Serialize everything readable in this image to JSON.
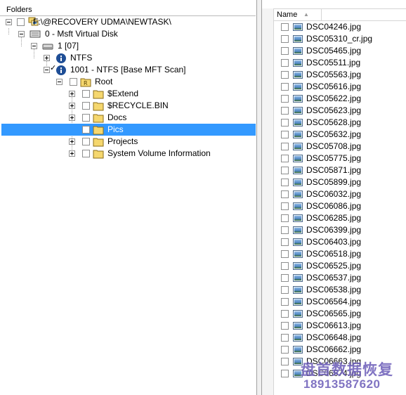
{
  "left_pane": {
    "header": "Folders",
    "tree": [
      {
        "id": "root-path",
        "label": "F:\\@RECOVERY UDMA\\NEWTASK\\",
        "icon": "computer-icon"
      },
      {
        "id": "disk",
        "label": "0 - Msft Virtual Disk",
        "icon": "disk-icon"
      },
      {
        "id": "partition",
        "label": "1 [07]",
        "icon": "drive-icon"
      },
      {
        "id": "ntfs",
        "label": "NTFS",
        "icon": "info-icon"
      },
      {
        "id": "mft-scan",
        "label": "1001 - NTFS [Base MFT Scan]",
        "icon": "info-icon"
      },
      {
        "id": "root",
        "label": "Root",
        "icon": "root-folder-icon"
      },
      {
        "id": "extend",
        "label": "$Extend",
        "icon": "folder-icon"
      },
      {
        "id": "recycle",
        "label": "$RECYCLE.BIN",
        "icon": "folder-icon"
      },
      {
        "id": "docs",
        "label": "Docs",
        "icon": "folder-icon"
      },
      {
        "id": "pics",
        "label": "Pics",
        "icon": "folder-icon"
      },
      {
        "id": "projects",
        "label": "Projects",
        "icon": "folder-icon"
      },
      {
        "id": "svi",
        "label": "System Volume Information",
        "icon": "folder-icon"
      }
    ],
    "selected": "Pics"
  },
  "right_pane": {
    "column_header": "Name",
    "files": [
      "DSC04246.jpg",
      "DSC05310_cr.jpg",
      "DSC05465.jpg",
      "DSC05511.jpg",
      "DSC05563.jpg",
      "DSC05616.jpg",
      "DSC05622.jpg",
      "DSC05623.jpg",
      "DSC05628.jpg",
      "DSC05632.jpg",
      "DSC05708.jpg",
      "DSC05775.jpg",
      "DSC05871.jpg",
      "DSC05899.jpg",
      "DSC06032.jpg",
      "DSC06086.jpg",
      "DSC06285.jpg",
      "DSC06399.jpg",
      "DSC06403.jpg",
      "DSC06518.jpg",
      "DSC06525.jpg",
      "DSC06537.jpg",
      "DSC06538.jpg",
      "DSC06564.jpg",
      "DSC06565.jpg",
      "DSC06613.jpg",
      "DSC06648.jpg",
      "DSC06662.jpg",
      "DSC06663.jpg",
      "DSC06674.jpg"
    ]
  },
  "watermark": {
    "line1": "盘首数据恢复",
    "line2": "18913587620"
  },
  "colors": {
    "selection": "#3399ff",
    "watermark": "#6a5bb8"
  }
}
